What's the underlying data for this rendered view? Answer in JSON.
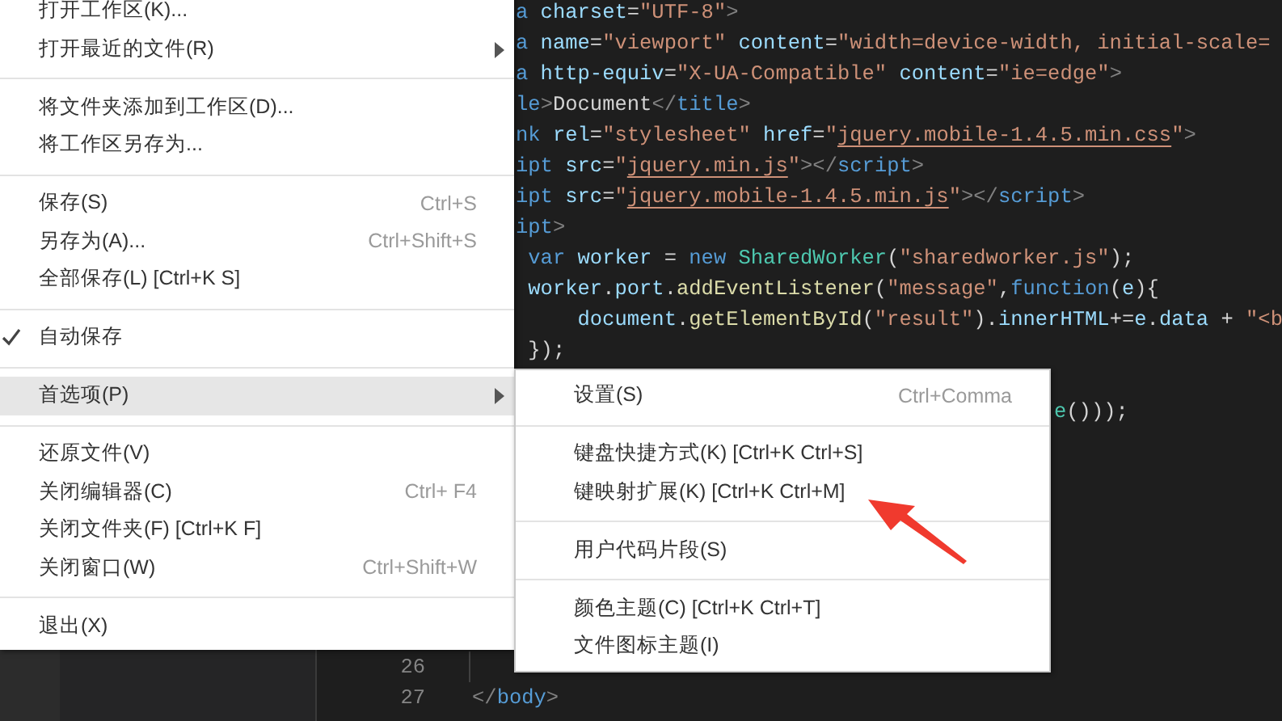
{
  "code_top": [
    {
      "tokens": [
        {
          "t": "a",
          "kind": "tag"
        },
        {
          "t": " charset",
          "kind": "attr"
        },
        {
          "t": "=",
          "kind": "text"
        },
        {
          "t": "\"UTF-8\"",
          "kind": "str"
        },
        {
          "t": ">",
          "kind": "punct"
        }
      ]
    },
    {
      "tokens": [
        {
          "t": "a",
          "kind": "tag"
        },
        {
          "t": " name",
          "kind": "attr"
        },
        {
          "t": "=",
          "kind": "text"
        },
        {
          "t": "\"viewport\"",
          "kind": "str"
        },
        {
          "t": " content",
          "kind": "attr"
        },
        {
          "t": "=",
          "kind": "text"
        },
        {
          "t": "\"width=device-width, initial-scale=",
          "kind": "str"
        }
      ]
    },
    {
      "tokens": [
        {
          "t": "a",
          "kind": "tag"
        },
        {
          "t": " http-equiv",
          "kind": "attr"
        },
        {
          "t": "=",
          "kind": "text"
        },
        {
          "t": "\"X-UA-Compatible\"",
          "kind": "str"
        },
        {
          "t": " content",
          "kind": "attr"
        },
        {
          "t": "=",
          "kind": "text"
        },
        {
          "t": "\"ie=edge\"",
          "kind": "str"
        },
        {
          "t": ">",
          "kind": "punct"
        }
      ]
    },
    {
      "tokens": [
        {
          "t": "le",
          "kind": "tag"
        },
        {
          "t": ">",
          "kind": "punct"
        },
        {
          "t": "Document",
          "kind": "text"
        },
        {
          "t": "</",
          "kind": "punct"
        },
        {
          "t": "title",
          "kind": "tag"
        },
        {
          "t": ">",
          "kind": "punct"
        }
      ]
    },
    {
      "tokens": [
        {
          "t": "nk",
          "kind": "tag"
        },
        {
          "t": " rel",
          "kind": "attr"
        },
        {
          "t": "=",
          "kind": "text"
        },
        {
          "t": "\"stylesheet\"",
          "kind": "str"
        },
        {
          "t": " href",
          "kind": "attr"
        },
        {
          "t": "=",
          "kind": "text"
        },
        {
          "t": "\"",
          "kind": "str"
        },
        {
          "t": "jquery.mobile-1.4.5.min.css",
          "kind": "link"
        },
        {
          "t": "\"",
          "kind": "str"
        },
        {
          "t": ">",
          "kind": "punct"
        }
      ]
    },
    {
      "tokens": [
        {
          "t": "ipt",
          "kind": "tag"
        },
        {
          "t": " src",
          "kind": "attr"
        },
        {
          "t": "=",
          "kind": "text"
        },
        {
          "t": "\"",
          "kind": "str"
        },
        {
          "t": "jquery.min.js",
          "kind": "link"
        },
        {
          "t": "\"",
          "kind": "str"
        },
        {
          "t": "></",
          "kind": "punct"
        },
        {
          "t": "script",
          "kind": "tag"
        },
        {
          "t": ">",
          "kind": "punct"
        }
      ]
    },
    {
      "tokens": [
        {
          "t": "ipt",
          "kind": "tag"
        },
        {
          "t": " src",
          "kind": "attr"
        },
        {
          "t": "=",
          "kind": "text"
        },
        {
          "t": "\"",
          "kind": "str"
        },
        {
          "t": "jquery.mobile-1.4.5.min.js",
          "kind": "link"
        },
        {
          "t": "\"",
          "kind": "str"
        },
        {
          "t": "></",
          "kind": "punct"
        },
        {
          "t": "script",
          "kind": "tag"
        },
        {
          "t": ">",
          "kind": "punct"
        }
      ]
    },
    {
      "tokens": [
        {
          "t": "ipt",
          "kind": "tag"
        },
        {
          "t": ">",
          "kind": "punct"
        }
      ]
    },
    {
      "tokens": [
        {
          "t": " var",
          "kind": "kw"
        },
        {
          "t": " worker",
          "kind": "var"
        },
        {
          "t": " = ",
          "kind": "text"
        },
        {
          "t": "new",
          "kind": "kw"
        },
        {
          "t": " SharedWorker",
          "kind": "cls"
        },
        {
          "t": "(",
          "kind": "text"
        },
        {
          "t": "\"sharedworker.js\"",
          "kind": "str"
        },
        {
          "t": ");",
          "kind": "text"
        }
      ]
    },
    {
      "tokens": [
        {
          "t": " worker",
          "kind": "var"
        },
        {
          "t": ".",
          "kind": "text"
        },
        {
          "t": "port",
          "kind": "var"
        },
        {
          "t": ".",
          "kind": "text"
        },
        {
          "t": "addEventListener",
          "kind": "fn"
        },
        {
          "t": "(",
          "kind": "text"
        },
        {
          "t": "\"message\"",
          "kind": "str"
        },
        {
          "t": ",",
          "kind": "text"
        },
        {
          "t": "function",
          "kind": "kw"
        },
        {
          "t": "(",
          "kind": "text"
        },
        {
          "t": "e",
          "kind": "var"
        },
        {
          "t": "){",
          "kind": "text"
        }
      ]
    },
    {
      "tokens": [
        {
          "t": "     document",
          "kind": "var"
        },
        {
          "t": ".",
          "kind": "text"
        },
        {
          "t": "getElementById",
          "kind": "fn"
        },
        {
          "t": "(",
          "kind": "text"
        },
        {
          "t": "\"result\"",
          "kind": "str"
        },
        {
          "t": ").",
          "kind": "text"
        },
        {
          "t": "innerHTML",
          "kind": "var"
        },
        {
          "t": "+=",
          "kind": "text"
        },
        {
          "t": "e",
          "kind": "var"
        },
        {
          "t": ".",
          "kind": "text"
        },
        {
          "t": "data",
          "kind": "var"
        },
        {
          "t": " + ",
          "kind": "text"
        },
        {
          "t": "\"<b",
          "kind": "str"
        }
      ]
    },
    {
      "tokens": [
        {
          "t": " });",
          "kind": "text"
        }
      ]
    }
  ],
  "code_right": [
    {
      "tokens": [
        {
          "t": "e",
          "kind": "cls"
        },
        {
          "t": "()));",
          "kind": "text"
        }
      ]
    }
  ],
  "code_bottom": [
    {
      "number": "26",
      "indent_guide": true
    },
    {
      "number": "27",
      "indent_guide": false,
      "tokens": [
        {
          "t": "</",
          "kind": "punct"
        },
        {
          "t": "body",
          "kind": "tag"
        },
        {
          "t": ">",
          "kind": "punct"
        }
      ]
    }
  ],
  "menu": [
    [
      {
        "label": "打开工作区(K)...",
        "checked": false,
        "selected": false,
        "submenu": false
      },
      {
        "label": "打开最近的文件(R)",
        "checked": false,
        "selected": false,
        "submenu": true
      }
    ],
    [
      {
        "label": "将文件夹添加到工作区(D)...",
        "checked": false,
        "selected": false,
        "submenu": false
      },
      {
        "label": "将工作区另存为...",
        "checked": false,
        "selected": false,
        "submenu": false
      }
    ],
    [
      {
        "label": "保存(S)",
        "shortcut": "Ctrl+S",
        "checked": false,
        "selected": false,
        "submenu": false
      },
      {
        "label": "另存为(A)...",
        "shortcut": "Ctrl+Shift+S",
        "checked": false,
        "selected": false,
        "submenu": false
      },
      {
        "label": "全部保存(L) [Ctrl+K S]",
        "checked": false,
        "selected": false,
        "submenu": false
      }
    ],
    [
      {
        "label": "自动保存",
        "checked": true,
        "selected": false,
        "submenu": false
      }
    ],
    [
      {
        "label": "首选项(P)",
        "checked": false,
        "selected": true,
        "submenu": true
      }
    ],
    [
      {
        "label": "还原文件(V)",
        "checked": false,
        "selected": false,
        "submenu": false
      },
      {
        "label": "关闭编辑器(C)",
        "shortcut": "Ctrl+  F4",
        "checked": false,
        "selected": false,
        "submenu": false
      },
      {
        "label": "关闭文件夹(F) [Ctrl+K F]",
        "checked": false,
        "selected": false,
        "submenu": false
      },
      {
        "label": "关闭窗口(W)",
        "shortcut": "Ctrl+Shift+W",
        "checked": false,
        "selected": false,
        "submenu": false
      }
    ],
    [
      {
        "label": "退出(X)",
        "checked": false,
        "selected": false,
        "submenu": false
      }
    ]
  ],
  "submenu": [
    [
      {
        "label": "设置(S)",
        "shortcut": "Ctrl+Comma"
      }
    ],
    [
      {
        "label": "键盘快捷方式(K) [Ctrl+K Ctrl+S]"
      },
      {
        "label": "键映射扩展(K) [Ctrl+K Ctrl+M]"
      }
    ],
    [
      {
        "label": "用户代码片段(S)"
      }
    ],
    [
      {
        "label": "颜色主题(C) [Ctrl+K Ctrl+T]"
      },
      {
        "label": "文件图标主题(I)"
      }
    ]
  ]
}
